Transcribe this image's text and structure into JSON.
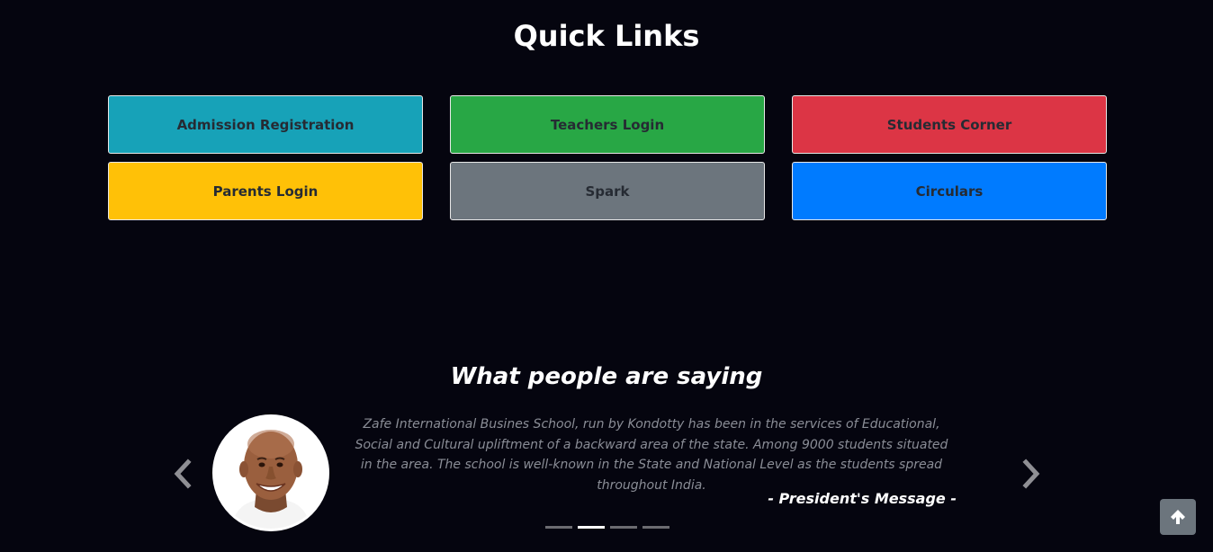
{
  "quick_links": {
    "title": "Quick Links",
    "buttons": [
      {
        "label": "Admission Registration",
        "color": "#17a2b8"
      },
      {
        "label": "Teachers Login",
        "color": "#28a745"
      },
      {
        "label": "Students Corner",
        "color": "#dc3545"
      },
      {
        "label": "Parents Login",
        "color": "#ffc107"
      },
      {
        "label": "Spark",
        "color": "#6c757d"
      },
      {
        "label": "Circulars",
        "color": "#007bff"
      }
    ]
  },
  "testimonials": {
    "title": "What people are saying",
    "quote": "Zafe International Busines School, run by Kondotty has been in the services of Educational, Social and Cultural upliftment of a backward area of the state. Among 9000 students situated in the area. The school is well-known in the State and National Level as the students spread throughout India.",
    "author": "- President's Message -",
    "slide_count": 4,
    "active_slide": 2,
    "prev_icon": "chevron-left-icon",
    "next_icon": "chevron-right-icon"
  },
  "back_to_top": {
    "icon": "arrow-up-icon",
    "color": "#6c757d"
  }
}
